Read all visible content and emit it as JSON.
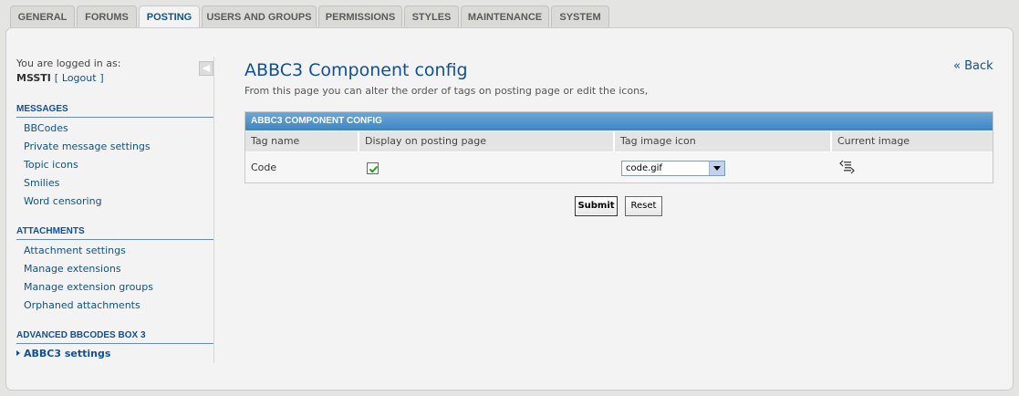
{
  "tabs": [
    {
      "label": "GENERAL",
      "active": false
    },
    {
      "label": "FORUMS",
      "active": false
    },
    {
      "label": "POSTING",
      "active": true
    },
    {
      "label": "USERS AND GROUPS",
      "active": false
    },
    {
      "label": "PERMISSIONS",
      "active": false
    },
    {
      "label": "STYLES",
      "active": false
    },
    {
      "label": "MAINTENANCE",
      "active": false
    },
    {
      "label": "SYSTEM",
      "active": false
    }
  ],
  "sidebar": {
    "logged_in_text": "You are logged in as:",
    "username": "MSSTI",
    "logout_open": "[",
    "logout_label": "Logout",
    "logout_close": "]",
    "sections": [
      {
        "title": "MESSAGES",
        "items": [
          "BBCodes",
          "Private message settings",
          "Topic icons",
          "Smilies",
          "Word censoring"
        ]
      },
      {
        "title": "ATTACHMENTS",
        "items": [
          "Attachment settings",
          "Manage extensions",
          "Manage extension groups",
          "Orphaned attachments"
        ]
      },
      {
        "title": "ADVANCED BBCODES BOX 3",
        "items": [
          "ABBC3 settings"
        ]
      }
    ]
  },
  "main": {
    "title": "ABBC3 Component config",
    "description": "From this page you can alter the order of tags on posting page or edit the icons,",
    "back_label": "« Back",
    "table": {
      "caption": "ABBC3 COMPONENT CONFIG",
      "columns": [
        "Tag name",
        "Display on posting page",
        "Tag image icon",
        "Current image"
      ],
      "rows": [
        {
          "tag_name": "Code",
          "display": true,
          "icon_file": "code.gif",
          "current_image_icon": "code-tag-icon"
        }
      ]
    },
    "buttons": {
      "submit": "Submit",
      "reset": "Reset"
    }
  },
  "colors": {
    "accent": "#115098",
    "caption_bg": "#4f93cc",
    "page_bg": "#e4e4e2",
    "panel_bg": "#f3f3f3"
  }
}
